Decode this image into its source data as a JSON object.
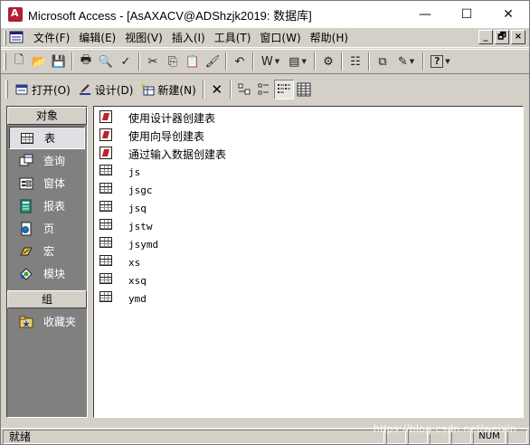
{
  "window": {
    "title": "Microsoft Access - [AsAXACV@ADShzjk2019: 数据库]",
    "controls": {
      "minimize": "—",
      "maximize": "☐",
      "close": "✕"
    }
  },
  "menubar": {
    "items": [
      {
        "label": "文件(F)"
      },
      {
        "label": "编辑(E)"
      },
      {
        "label": "视图(V)"
      },
      {
        "label": "插入(I)"
      },
      {
        "label": "工具(T)"
      },
      {
        "label": "窗口(W)"
      },
      {
        "label": "帮助(H)"
      }
    ],
    "mdi": {
      "minimize": "_",
      "restore": "🗗",
      "close": "×"
    }
  },
  "toolbar": {
    "buttons": [
      {
        "icon": "new-file-icon",
        "glyph": "🗋"
      },
      {
        "icon": "open-folder-icon",
        "glyph": "📂"
      },
      {
        "icon": "save-icon",
        "glyph": "💾"
      },
      {
        "icon": "print-icon",
        "glyph": "🖶"
      },
      {
        "icon": "print-preview-icon",
        "glyph": "🔍"
      },
      {
        "icon": "spelling-icon",
        "glyph": "✓"
      },
      {
        "icon": "cut-icon",
        "glyph": "✂"
      },
      {
        "icon": "copy-icon",
        "glyph": "⎘"
      },
      {
        "icon": "paste-icon",
        "glyph": "📋"
      },
      {
        "icon": "format-painter-icon",
        "glyph": "🖌"
      },
      {
        "icon": "undo-icon",
        "glyph": "↶"
      },
      {
        "icon": "office-links-icon",
        "glyph": "W"
      },
      {
        "icon": "analyze-icon",
        "glyph": "▤"
      },
      {
        "icon": "code-icon",
        "glyph": "⚙"
      },
      {
        "icon": "properties-icon",
        "glyph": "☷"
      },
      {
        "icon": "relationships-icon",
        "glyph": "⧉"
      },
      {
        "icon": "new-object-icon",
        "glyph": "✎"
      },
      {
        "icon": "help-icon",
        "glyph": "?"
      }
    ]
  },
  "db_toolbar": {
    "open": "打开(O)",
    "design": "设计(D)",
    "new": "新建(N)",
    "delete_glyph": "✕"
  },
  "objects": {
    "header": "对象",
    "items": [
      {
        "label": "表",
        "icon": "table-icon"
      },
      {
        "label": "查询",
        "icon": "query-icon"
      },
      {
        "label": "窗体",
        "icon": "form-icon"
      },
      {
        "label": "报表",
        "icon": "report-icon"
      },
      {
        "label": "页",
        "icon": "page-icon"
      },
      {
        "label": "宏",
        "icon": "macro-icon"
      },
      {
        "label": "模块",
        "icon": "module-icon"
      }
    ],
    "groups_header": "组",
    "groups": [
      {
        "label": "收藏夹",
        "icon": "favorites-icon"
      }
    ]
  },
  "list": {
    "shortcuts": [
      {
        "label": "使用设计器创建表"
      },
      {
        "label": "使用向导创建表"
      },
      {
        "label": "通过输入数据创建表"
      }
    ],
    "tables": [
      {
        "label": "js"
      },
      {
        "label": "jsgc"
      },
      {
        "label": "jsq"
      },
      {
        "label": "jstw"
      },
      {
        "label": "jsymd"
      },
      {
        "label": "xs"
      },
      {
        "label": "xsq"
      },
      {
        "label": "ymd"
      }
    ]
  },
  "statusbar": {
    "text": "就绪",
    "num": "NUM",
    "watermark": "https://blog.csdn.net/weixin"
  }
}
